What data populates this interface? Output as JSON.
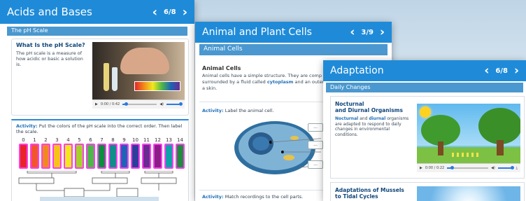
{
  "cards": {
    "ph": {
      "title": "Acids and Bases",
      "page": "6/8",
      "section": "The pH Scale",
      "heading": "What Is the pH Scale?",
      "body": "The pH scale is a measure of how acidic or basic a solution is.",
      "video_time": "0:00 / 0:42",
      "activity_label": "Activity:",
      "activity_text": "Put the colors of the pH scale into the correct order. Then label the scale.",
      "scale_numbers": [
        "0",
        "1",
        "2",
        "3",
        "4",
        "5",
        "6",
        "7",
        "8",
        "9",
        "10",
        "11",
        "12",
        "13",
        "14"
      ],
      "swatch_colors": [
        "#e8232a",
        "#f2552c",
        "#f08a1d",
        "#f7c21a",
        "#f2e81e",
        "#a7d12a",
        "#4db848",
        "#0a8f3c",
        "#0f8d8b",
        "#1c64b6",
        "#2b3f9a",
        "#6a2c90",
        "#8b1e86",
        "#0fa2a8",
        "#1b8f3a"
      ]
    },
    "cells": {
      "title": "Animal and Plant Cells",
      "page": "3/9",
      "section": "Animal Cells",
      "heading": "Animal Cells",
      "body_1": "Animal cells have a simple structure. They are comp",
      "body_2": "surrounded by a fluid called",
      "body_kw": "cytoplasm",
      "body_3": "and an outer",
      "body_4": "a skin.",
      "activity_label": "Activity:",
      "activity_text": "Label the animal cell.",
      "label_boxes": [
        "...",
        "...",
        "..."
      ],
      "activity2_label": "Activity:",
      "activity2_text": "Match recordings to the cell parts."
    },
    "adapt": {
      "title": "Adaptation",
      "page": "6/8",
      "section": "Daily Changes",
      "heading_1": "Nocturnal",
      "heading_2": "and Diurnal Organisms",
      "kw_1": "Nocturnal",
      "body_and": "and",
      "kw_2": "diurnal",
      "body_rest": "organisms are adapted to respond to daily changes in environmental conditions.",
      "video_time": "0:00 / 0:22",
      "heading2_1": "Adaptations of Mussels",
      "heading2_2": "to Tidal Cycles"
    }
  },
  "icons": {
    "prev": "‹",
    "next": "›",
    "play": "▶",
    "volume": "◀)",
    "download": "⤓"
  },
  "colors": {
    "titlebar": "#1f8bd8",
    "section": "#4a98cf",
    "heading": "#10467a",
    "swatch_border": "#ff3df0"
  }
}
